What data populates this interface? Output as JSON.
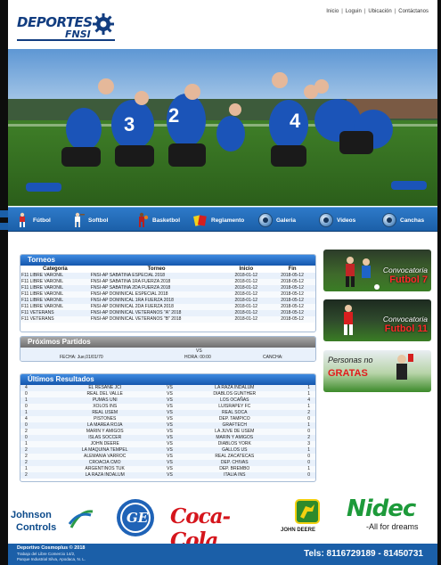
{
  "brand": {
    "logo_word": "DEPORTES",
    "logo_sub": "FNSI"
  },
  "topnav": {
    "items": [
      "Inicio",
      "Loguin",
      "Ubicación",
      "Contáctanos"
    ]
  },
  "menu": {
    "items": [
      {
        "label": "Fútbol",
        "icon": "soccer-player-icon"
      },
      {
        "label": "Softbol",
        "icon": "softball-player-icon"
      },
      {
        "label": "Basketbol",
        "icon": "basketball-player-icon"
      },
      {
        "label": "Reglamento",
        "icon": "referee-cards-icon"
      },
      {
        "label": "Galeria",
        "icon": "round-button-icon"
      },
      {
        "label": "Videos",
        "icon": "round-button-icon"
      },
      {
        "label": "Canchas",
        "icon": "round-button-icon"
      }
    ]
  },
  "torneos": {
    "title": "Torneos",
    "columns": [
      "Categoría",
      "Torneo",
      "Inicio",
      "Fin"
    ],
    "rows": [
      [
        "F11 LIBRE VARONIL",
        "FNSI-AP SABATINA ESPECIAL 2018",
        "2018-01-12",
        "2018-05-12"
      ],
      [
        "F11 LIBRE VARONIL",
        "FNSI-AP SABATINA 1RA FUERZA 2018",
        "2018-01-12",
        "2018-05-12"
      ],
      [
        "F11 LIBRE VARONIL",
        "FNSI-AP SABATINA 2DA FUERZA 2018",
        "2018-01-12",
        "2018-05-12"
      ],
      [
        "F11 LIBRE VARONIL",
        "FNSI-AP DOMINICAL ESPECIAL 2018",
        "2018-01-12",
        "2018-05-12"
      ],
      [
        "F11 LIBRE VARONIL",
        "FNSI-AP DOMINICAL 1RA FUERZA 2018",
        "2018-01-12",
        "2018-05-12"
      ],
      [
        "F11 LIBRE VARONIL",
        "FNSI-AP DOMINICAL 2DA FUERZA 2018",
        "2018-01-12",
        "2018-05-12"
      ],
      [
        "F11 VETERANS",
        "FNSI-AP DOMINICAL VETERANOS \"A\" 2018",
        "2018-01-12",
        "2018-05-12"
      ],
      [
        "F11 VETERANS",
        "FNSI-AP DOMINICAL VETERANOS \"B\" 2018",
        "2018-01-12",
        "2018-05-12"
      ]
    ]
  },
  "proximos": {
    "title": "Próximos Partidos",
    "vs": "VS",
    "fecha_label": "FECHA: Jue,01/01/70",
    "hora_label": "HORA: 00:00",
    "cancha_label": "CANCHA:"
  },
  "resultados": {
    "title": "Últimos Resultados",
    "rows": [
      [
        "4",
        "EL RESANE JCI",
        "VS",
        "LA RAZA INDALUM",
        "1"
      ],
      [
        "0",
        "REAL DEL VALLE",
        "VS",
        "DIABLOS GUNTHER",
        "1"
      ],
      [
        "1",
        "PUMAS UNI",
        "VS",
        "LOS OCAÑAS",
        "4"
      ],
      [
        "0",
        "XOLOS INS",
        "VS",
        "LUISRAPEY FC",
        "1"
      ],
      [
        "1",
        "REAL USEM",
        "VS",
        "REAL SOCA",
        "2"
      ],
      [
        "4",
        "PISTONES",
        "VS",
        "DEP. TAMPICO",
        "0"
      ],
      [
        "0",
        "LA MAREA ROJA",
        "VS",
        "GRAFTECH",
        "1"
      ],
      [
        "2",
        "MARIN Y AMIGOS",
        "VS",
        "LA JUVE DE USEM",
        "0"
      ],
      [
        "0",
        "ISLAS SOCCER",
        "VS",
        "MARIN Y AMIGOS",
        "2"
      ],
      [
        "1",
        "JOHN DEERE",
        "VS",
        "DIABLOS YORK",
        "3"
      ],
      [
        "2",
        "LA MAQUINA TEMPEL",
        "VS",
        "GALLOS US",
        "1"
      ],
      [
        "2",
        "ALEMANIA VARROC",
        "VS",
        "REAL ZACATECAS",
        "0"
      ],
      [
        "2",
        "CROACIA CMO",
        "VS",
        "DEP. CHIVAS",
        "0"
      ],
      [
        "1",
        "ARGENTINOS TUK",
        "VS",
        "DEP. BREMBO",
        "1"
      ],
      [
        "2",
        "LA RAZA INDALUM",
        "VS",
        "ITALIA INS",
        "0"
      ]
    ]
  },
  "banners": [
    {
      "line1": "Convocatoria",
      "line2": "Futbol 7"
    },
    {
      "line1": "Convocatoria",
      "line2": "Futbol 11"
    },
    {
      "line1": "Personas no",
      "line2": "GRATAS"
    }
  ],
  "sponsors": {
    "johnson_line1": "Johnson",
    "johnson_line2": "Controls",
    "ge": "GE",
    "coca": "Coca-Cola",
    "deere": "JOHN DEERE",
    "nidec": "Nidec",
    "nidec_tag": "-All for dreams"
  },
  "footer": {
    "line1": "Deportivo Cosmoplus © 2018",
    "line2": "Trabajo del Libre Comercio 14/2,",
    "line3": "Parque Industrial Silva, Apodaca, N. L.",
    "phone": "Tels: 8116729189 - 81450731"
  },
  "colors": {
    "accent": "#1b5fa8",
    "banner_red": "#ff2a2a"
  }
}
